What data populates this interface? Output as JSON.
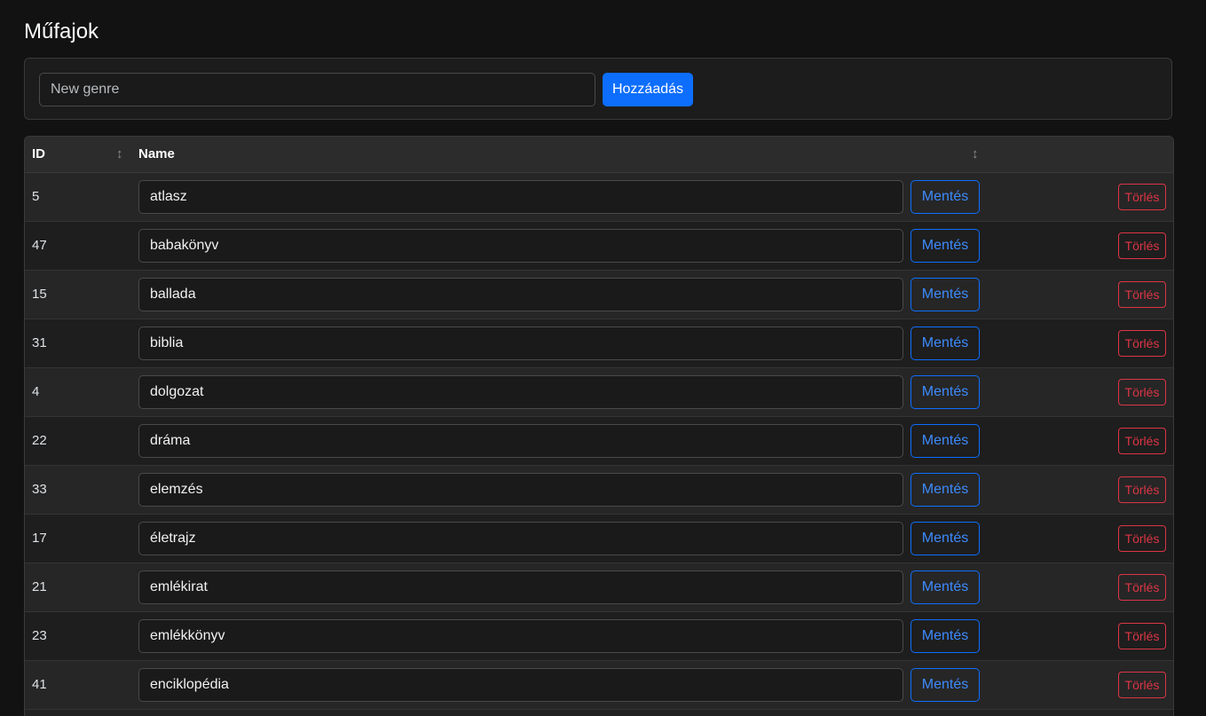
{
  "page": {
    "title": "Műfajok"
  },
  "add_form": {
    "placeholder": "New genre",
    "value": "",
    "add_label": "Hozzáadás"
  },
  "table": {
    "columns": {
      "id": "ID",
      "name": "Name"
    },
    "sort_icon": "↕",
    "save_label": "Mentés",
    "delete_label": "Törlés",
    "rows": [
      {
        "id": "5",
        "name": "atlasz"
      },
      {
        "id": "47",
        "name": "babakönyv"
      },
      {
        "id": "15",
        "name": "ballada"
      },
      {
        "id": "31",
        "name": "biblia"
      },
      {
        "id": "4",
        "name": "dolgozat"
      },
      {
        "id": "22",
        "name": "dráma"
      },
      {
        "id": "33",
        "name": "elemzés"
      },
      {
        "id": "17",
        "name": "életrajz"
      },
      {
        "id": "21",
        "name": "emlékirat"
      },
      {
        "id": "23",
        "name": "emlékkönyv"
      },
      {
        "id": "41",
        "name": "enciklopédia"
      }
    ]
  },
  "colors": {
    "background": "#121212",
    "primary": "#0d6efd",
    "danger": "#dc3545"
  }
}
